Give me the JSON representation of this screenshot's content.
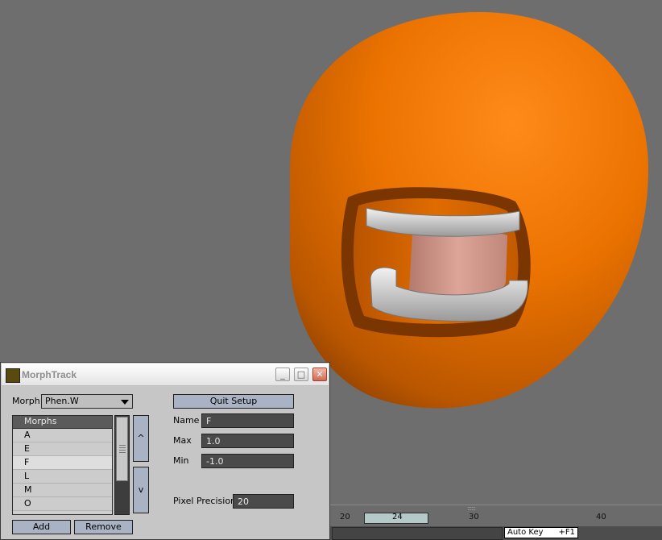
{
  "window": {
    "title": "MorphTrack",
    "minimize_glyph": "_",
    "maximize_glyph": "□",
    "close_glyph": "✕"
  },
  "form": {
    "morph_label": "Morph",
    "morph_value": "Phen.W",
    "quit_setup_label": "Quit Setup",
    "name_label": "Name",
    "name_value": "F",
    "max_label": "Max",
    "max_value": "1.0",
    "min_label": "Min",
    "min_value": "-1.0",
    "pixel_precision_label": "Pixel Precision",
    "pixel_precision_value": "20",
    "add_label": "Add",
    "remove_label": "Remove",
    "up_glyph": "^",
    "down_glyph": "v"
  },
  "morphs": {
    "header": "Morphs",
    "items": [
      "A",
      "E",
      "F",
      "L",
      "M",
      "O"
    ],
    "selected": "F"
  },
  "timeline": {
    "ticks": [
      "20",
      "24",
      "30",
      "40"
    ],
    "current_frame": "24",
    "auto_key_label": "Auto Key",
    "auto_key_hotkey": "+F1"
  },
  "colors": {
    "viewport_bg": "#6e6e6e",
    "head_orange": "#e87000",
    "teeth_gray": "#cfcfcf",
    "tongue_pink": "#d49a8c",
    "button_blue": "#a9b3c3",
    "field_dark": "#4a4a4a"
  }
}
